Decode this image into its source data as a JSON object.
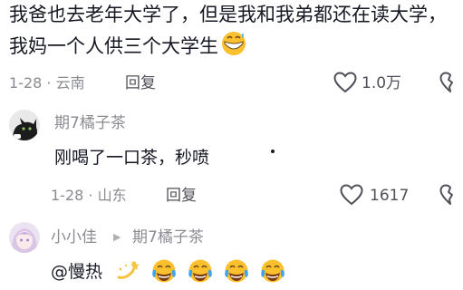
{
  "post_comment": {
    "text": "我爸也去老年大学了，但是我和我弟都还在读大学，我妈一个人供三个大学生",
    "meta": "1-28 · 云南",
    "reply_label": "回复",
    "like_count": "1.0万",
    "emoji_icon": "grinning-sweat-emoji-icon"
  },
  "reply_1": {
    "username": "期7橘子茶",
    "text": "刚喝了一口茶，秒喷",
    "meta": "1-28 · 山东",
    "reply_label": "回复",
    "like_count": "1617"
  },
  "reply_2": {
    "username": "小小佳",
    "arrow": "▶",
    "reply_to": "期7橘子茶",
    "text": "@慢热",
    "emoji_icons": [
      "dizzy-emoji-icon",
      "crying-laughing-emoji-icon",
      "crying-laughing-emoji-icon",
      "crying-laughing-emoji-icon",
      "crying-laughing-emoji-icon"
    ]
  },
  "colors": {
    "text_primary": "#161823",
    "text_secondary": "#8a8b91",
    "icon_gray": "#4f5059"
  }
}
